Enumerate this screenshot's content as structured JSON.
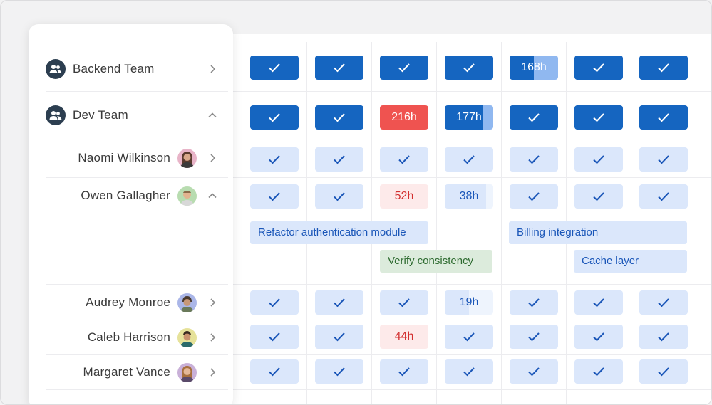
{
  "colors": {
    "accent": "#1565c0",
    "accent_light": "#dbe7fb",
    "over": "#ef5350",
    "over_light": "#fdeaea",
    "team_icon": "#2c3e50",
    "task_green": "#dcebdc"
  },
  "sidebar": {
    "teams": [
      {
        "label": "Backend Team",
        "icon": "people-icon",
        "expanded": false
      },
      {
        "label": "Dev Team",
        "icon": "people-icon",
        "expanded": true
      }
    ],
    "members": [
      {
        "name": "Naomi Wilkinson",
        "expanded": false
      },
      {
        "name": "Owen Gallagher",
        "expanded": true
      },
      {
        "name": "Audrey Monroe",
        "expanded": false
      },
      {
        "name": "Caleb Harrison",
        "expanded": false
      },
      {
        "name": "Margaret Vance",
        "expanded": false
      }
    ]
  },
  "grid": {
    "rows": [
      {
        "row": "backend-team",
        "cells": [
          {
            "kind": "check",
            "style": "dark"
          },
          {
            "kind": "check",
            "style": "dark"
          },
          {
            "kind": "check",
            "style": "dark"
          },
          {
            "kind": "check",
            "style": "dark"
          },
          {
            "kind": "hours",
            "style": "dark",
            "text": "168h",
            "fill": 0.5
          },
          {
            "kind": "check",
            "style": "dark"
          },
          {
            "kind": "check",
            "style": "dark"
          }
        ]
      },
      {
        "row": "dev-team",
        "cells": [
          {
            "kind": "check",
            "style": "dark"
          },
          {
            "kind": "check",
            "style": "dark"
          },
          {
            "kind": "hours",
            "style": "red-dark",
            "text": "216h",
            "fill": 1
          },
          {
            "kind": "hours",
            "style": "dark",
            "text": "177h",
            "fill": 0.78
          },
          {
            "kind": "check",
            "style": "dark"
          },
          {
            "kind": "check",
            "style": "dark"
          },
          {
            "kind": "check",
            "style": "dark"
          }
        ]
      },
      {
        "row": "naomi-wilkinson",
        "cells": [
          {
            "kind": "check",
            "style": "light"
          },
          {
            "kind": "check",
            "style": "light"
          },
          {
            "kind": "check",
            "style": "light"
          },
          {
            "kind": "check",
            "style": "light"
          },
          {
            "kind": "check",
            "style": "light"
          },
          {
            "kind": "check",
            "style": "light"
          },
          {
            "kind": "check",
            "style": "light"
          }
        ]
      },
      {
        "row": "owen-gallagher",
        "cells": [
          {
            "kind": "check",
            "style": "light"
          },
          {
            "kind": "check",
            "style": "light"
          },
          {
            "kind": "hours",
            "style": "red-light",
            "text": "52h",
            "fill": 1
          },
          {
            "kind": "hours",
            "style": "light",
            "text": "38h",
            "fill": 0.85
          },
          {
            "kind": "check",
            "style": "light"
          },
          {
            "kind": "check",
            "style": "light"
          },
          {
            "kind": "check",
            "style": "light"
          }
        ]
      },
      {
        "row": "audrey-monroe",
        "cells": [
          {
            "kind": "check",
            "style": "light"
          },
          {
            "kind": "check",
            "style": "light"
          },
          {
            "kind": "check",
            "style": "light"
          },
          {
            "kind": "hours",
            "style": "light",
            "text": "19h",
            "fill": 0.5
          },
          {
            "kind": "check",
            "style": "light"
          },
          {
            "kind": "check",
            "style": "light"
          },
          {
            "kind": "check",
            "style": "light"
          }
        ]
      },
      {
        "row": "caleb-harrison",
        "cells": [
          {
            "kind": "check",
            "style": "light"
          },
          {
            "kind": "check",
            "style": "light"
          },
          {
            "kind": "hours",
            "style": "red-light",
            "text": "44h",
            "fill": 1
          },
          {
            "kind": "check",
            "style": "light"
          },
          {
            "kind": "check",
            "style": "light"
          },
          {
            "kind": "check",
            "style": "light"
          },
          {
            "kind": "check",
            "style": "light"
          }
        ]
      },
      {
        "row": "margaret-vance",
        "cells": [
          {
            "kind": "check",
            "style": "light"
          },
          {
            "kind": "check",
            "style": "light"
          },
          {
            "kind": "check",
            "style": "light"
          },
          {
            "kind": "check",
            "style": "light"
          },
          {
            "kind": "check",
            "style": "light"
          },
          {
            "kind": "check",
            "style": "light"
          },
          {
            "kind": "check",
            "style": "light"
          }
        ]
      }
    ],
    "tasks": [
      {
        "label": "Refactor authentication module",
        "color": "blue"
      },
      {
        "label": "Billing integration",
        "color": "blue"
      },
      {
        "label": "Verify consistency",
        "color": "green"
      },
      {
        "label": "Cache layer",
        "color": "blue"
      }
    ]
  }
}
